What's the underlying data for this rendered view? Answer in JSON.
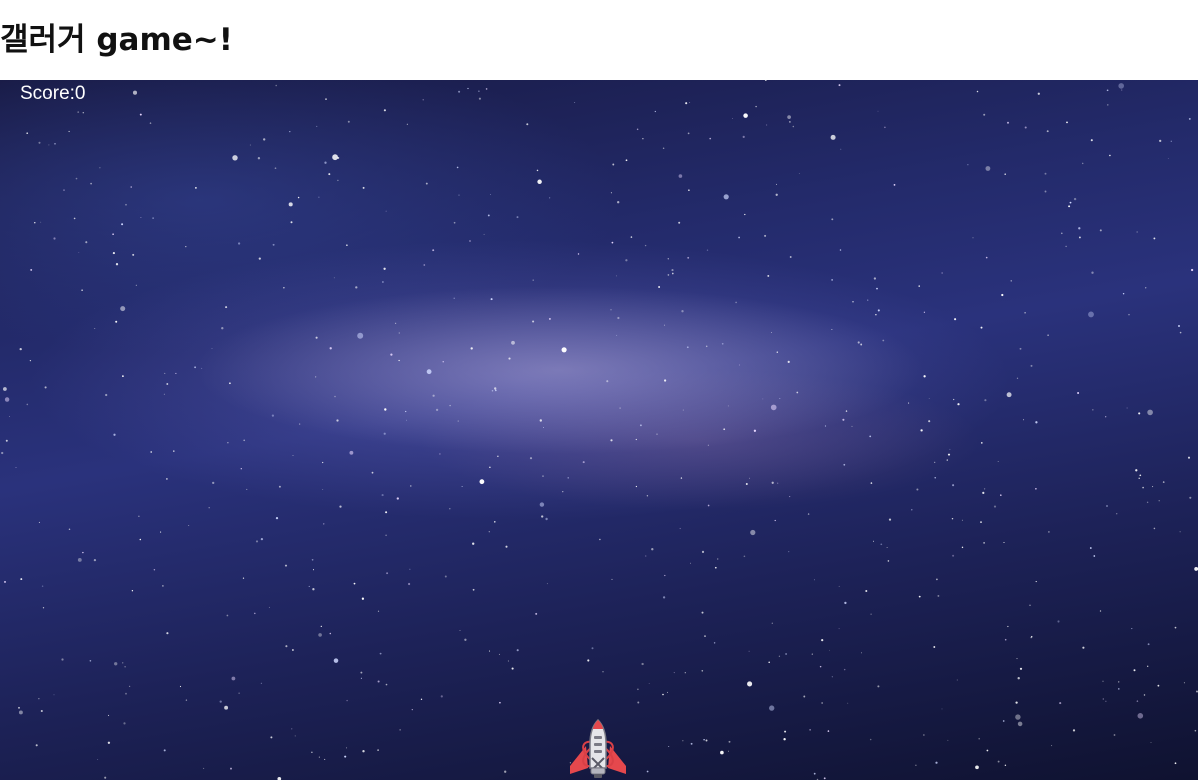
{
  "page": {
    "title": "갤러거 game~!"
  },
  "game": {
    "score_text": "Score:0",
    "background": "starfield-image",
    "player_icon": "spaceship-icon",
    "colors": {
      "ship_red": "#e5484d",
      "ship_white": "#e6e6ea",
      "ship_gray": "#7a7a85",
      "sky_dark": "#10122f",
      "sky_mid": "#2a327c"
    }
  }
}
